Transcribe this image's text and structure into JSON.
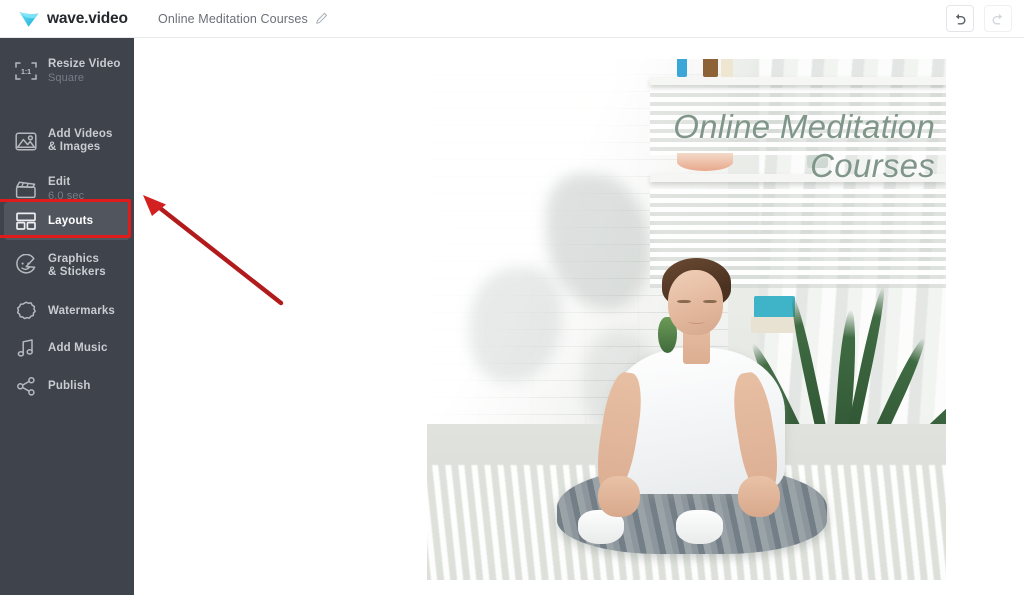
{
  "header": {
    "brand_name": "wave.video",
    "brand_icon": "wave-play-logo-icon",
    "project_title": "Online Meditation Courses",
    "edit_title_icon": "pencil-icon",
    "undo_icon": "undo-arrow-icon",
    "redo_icon": "redo-arrow-icon"
  },
  "sidebar": {
    "items": [
      {
        "id": "resize-video",
        "icon": "crop-ratio-1-1-icon",
        "label": "Resize Video",
        "sub": "Square",
        "active": false
      },
      {
        "id": "add-videos-images",
        "icon": "image-mountain-icon",
        "label": "Add Videos",
        "label2": "& Images",
        "sub": "",
        "active": false
      },
      {
        "id": "edit",
        "icon": "clapperboard-icon",
        "label": "Edit",
        "sub": "6.0 sec",
        "active": false
      },
      {
        "id": "layouts",
        "icon": "layout-grid-icon",
        "label": "Layouts",
        "sub": "",
        "active": true
      },
      {
        "id": "graphics-stickers",
        "icon": "smiley-sticker-icon",
        "label": "Graphics",
        "label2": "& Stickers",
        "sub": "",
        "active": false
      },
      {
        "id": "watermarks",
        "icon": "seal-badge-icon",
        "label": "Watermarks",
        "sub": "",
        "active": false
      },
      {
        "id": "add-music",
        "icon": "music-note-icon",
        "label": "Add Music",
        "sub": "",
        "active": false
      },
      {
        "id": "publish",
        "icon": "share-nodes-icon",
        "label": "Publish",
        "sub": "",
        "active": false
      }
    ]
  },
  "annotation": {
    "highlight_color": "#e01b1b",
    "highlight_target": "layouts",
    "arrow_color": "#b21b1b",
    "arrow_points_to": "layouts"
  },
  "canvas": {
    "aspect_label": "Square",
    "overlay_text_line1": "Online Meditation",
    "overlay_text_line2": "Courses",
    "overlay_text_color": "#7f9689",
    "scene_description": "woman meditating cross-legged on white rug in bright sunlit white brick room with shelves and potted palm"
  }
}
